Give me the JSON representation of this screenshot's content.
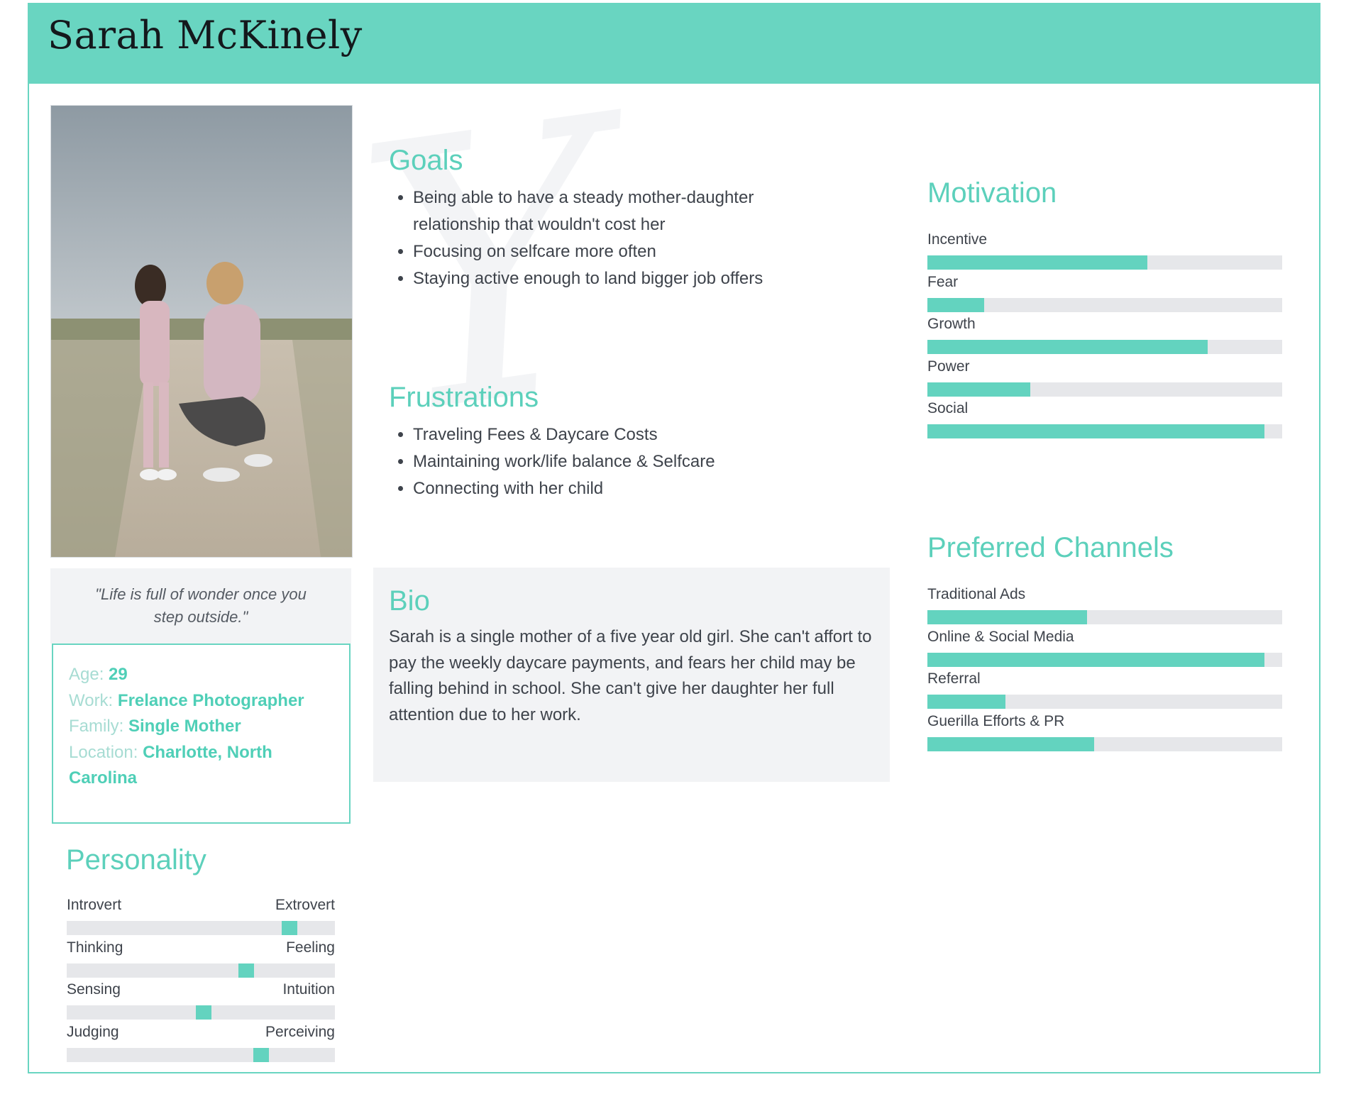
{
  "persona": {
    "name": "Sarah McKinely",
    "quote": "\"Life is full of wonder once you step outside.\"",
    "info": [
      {
        "label": "Age: ",
        "value": "29"
      },
      {
        "label": "Work: ",
        "value": "Frelance Photographer"
      },
      {
        "label": "Family: ",
        "value": "Single Mother"
      },
      {
        "label": "Location: ",
        "value": "Charlotte, North Carolina"
      }
    ]
  },
  "goals": {
    "title": "Goals",
    "items": [
      "Being able to have a steady mother-daughter relationship that wouldn't cost her",
      "Focusing on selfcare more often",
      "Staying active enough to land bigger job offers"
    ]
  },
  "frustrations": {
    "title": "Frustrations",
    "items": [
      "Traveling Fees & Daycare Costs",
      "Maintaining work/life balance & Selfcare",
      "Connecting with her child"
    ]
  },
  "bio": {
    "title": "Bio",
    "text": "Sarah is a single mother of a five year old girl. She can't affort to pay the weekly daycare payments, and fears her child may be falling behind in school. She can't give her daughter her full attention due to her work."
  },
  "personality": {
    "title": "Personality",
    "scales": [
      {
        "left": "Introvert",
        "right": "Extrovert",
        "level": 0.85
      },
      {
        "left": "Thinking",
        "right": "Feeling",
        "level": 0.68
      },
      {
        "left": "Sensing",
        "right": "Intuition",
        "level": 0.51
      },
      {
        "left": "Judging",
        "right": "Perceiving",
        "level": 0.74
      }
    ]
  },
  "motivation": {
    "title": "Motivation",
    "bars": [
      {
        "label": "Incentive",
        "level": 0.62
      },
      {
        "label": "Fear",
        "level": 0.16
      },
      {
        "label": "Growth",
        "level": 0.79
      },
      {
        "label": "Power",
        "level": 0.29
      },
      {
        "label": "Social",
        "level": 0.95
      }
    ]
  },
  "channels": {
    "title": "Preferred Channels",
    "bars": [
      {
        "label": "Traditional Ads",
        "level": 0.45
      },
      {
        "label": "Online & Social Media",
        "level": 0.95
      },
      {
        "label": "Referral",
        "level": 0.22
      },
      {
        "label": "Guerilla Efforts & PR",
        "level": 0.47
      }
    ]
  },
  "colors": {
    "accent": "#69d5c1",
    "bar_fill": "#63d3bf",
    "track": "#e6e7ea",
    "panel": "#f2f3f5"
  }
}
